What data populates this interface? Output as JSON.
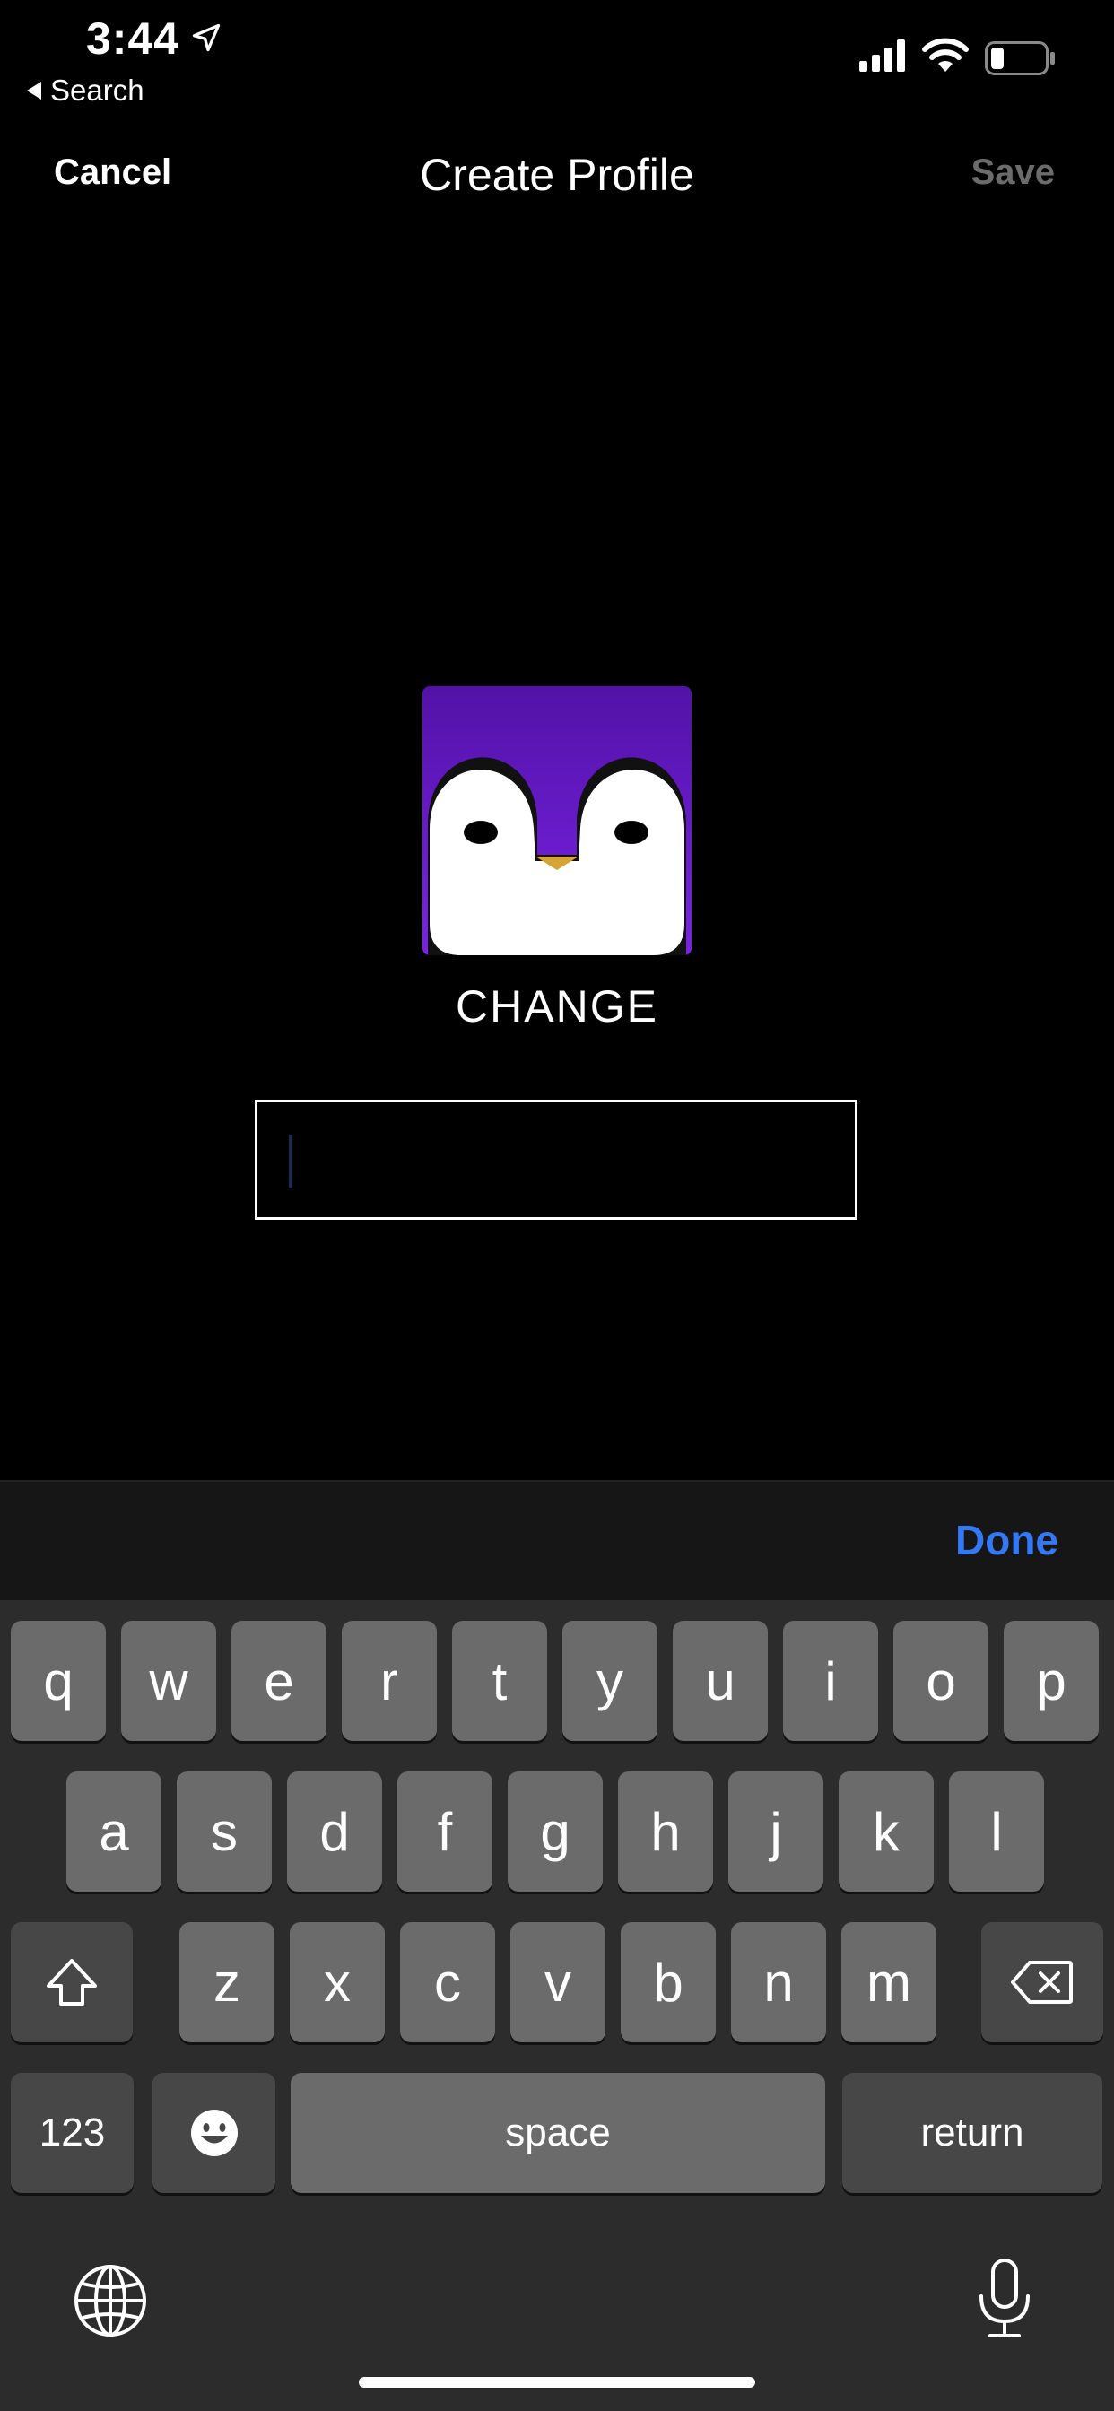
{
  "status_bar": {
    "time": "3:44",
    "back_label": "Search",
    "icons": [
      "location-arrow-icon",
      "cellular-signal-icon",
      "wifi-icon",
      "battery-icon"
    ]
  },
  "nav": {
    "cancel": "Cancel",
    "title": "Create Profile",
    "save": "Save"
  },
  "profile": {
    "avatar": "penguin-avatar",
    "change": "CHANGE",
    "name_value": ""
  },
  "keyboard": {
    "done": "Done",
    "row1": [
      "q",
      "w",
      "e",
      "r",
      "t",
      "y",
      "u",
      "i",
      "o",
      "p"
    ],
    "row2": [
      "a",
      "s",
      "d",
      "f",
      "g",
      "h",
      "j",
      "k",
      "l"
    ],
    "row3": [
      "z",
      "x",
      "c",
      "v",
      "b",
      "n",
      "m"
    ],
    "numbers": "123",
    "space": "space",
    "return": "return"
  },
  "colors": {
    "background": "#000000",
    "accent": "#3478f6",
    "avatar_purple": "#6a1fd0",
    "keyboard_bg": "#2c2c2c",
    "key": "#6b6b6b",
    "key_dark": "#474747"
  }
}
